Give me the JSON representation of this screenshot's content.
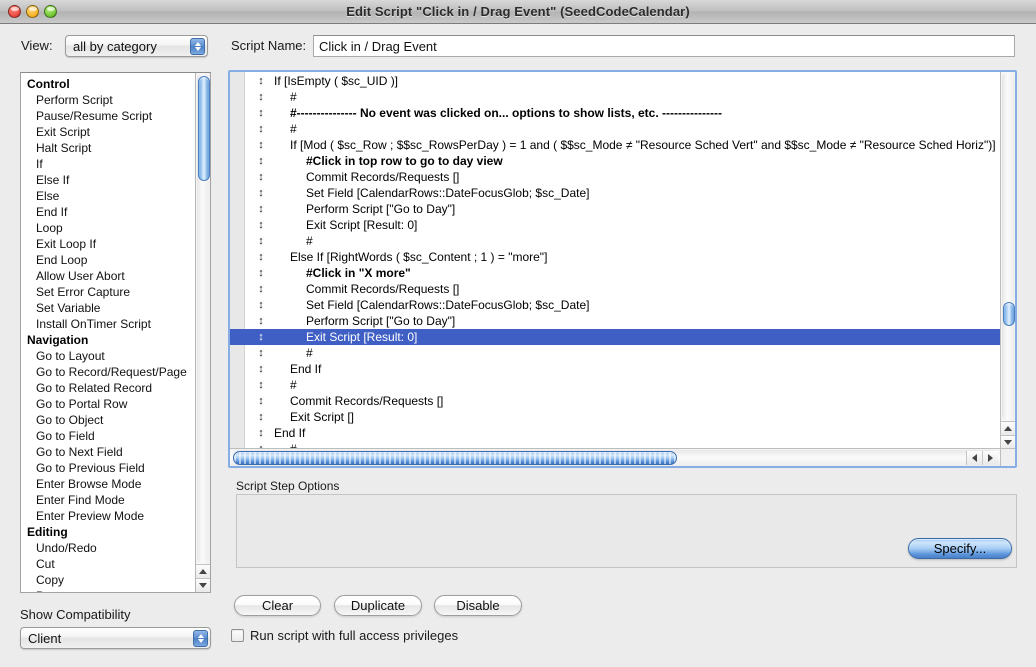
{
  "window": {
    "title": "Edit Script \"Click in / Drag Event\" (SeedCodeCalendar)",
    "close_icon": "close-icon",
    "minimize_icon": "minimize-icon",
    "zoom_icon": "zoom-icon"
  },
  "toolbar": {
    "view_label": "View:",
    "view_value": "all by category",
    "script_name_label": "Script Name:",
    "script_name_value": "Click in / Drag Event"
  },
  "sidebar": {
    "categories": [
      {
        "name": "Control",
        "items": [
          "Perform Script",
          "Pause/Resume Script",
          "Exit Script",
          "Halt Script",
          "If",
          "Else If",
          "Else",
          "End If",
          "Loop",
          "Exit Loop If",
          "End Loop",
          "Allow User Abort",
          "Set Error Capture",
          "Set Variable",
          "Install OnTimer Script"
        ]
      },
      {
        "name": "Navigation",
        "items": [
          "Go to Layout",
          "Go to Record/Request/Page",
          "Go to Related Record",
          "Go to Portal Row",
          "Go to Object",
          "Go to Field",
          "Go to Next Field",
          "Go to Previous Field",
          "Enter Browse Mode",
          "Enter Find Mode",
          "Enter Preview Mode"
        ]
      },
      {
        "name": "Editing",
        "items": [
          "Undo/Redo",
          "Cut",
          "Copy",
          "Paste"
        ]
      }
    ],
    "compatibility_label": "Show Compatibility",
    "compatibility_value": "Client"
  },
  "script": {
    "handle_glyph": "↕",
    "selected_index": 16,
    "lines": [
      {
        "indent": 0,
        "text": "If [IsEmpty ( $sc_UID )]",
        "bold": false
      },
      {
        "indent": 1,
        "text": "#",
        "bold": false
      },
      {
        "indent": 1,
        "text": "#---------------  No event was clicked on... options to show lists, etc.  ---------------",
        "bold": true
      },
      {
        "indent": 1,
        "text": "#",
        "bold": false
      },
      {
        "indent": 1,
        "text": "If [Mod ( $sc_Row ; $$sc_RowsPerDay ) = 1 and ( $$sc_Mode ≠ \"Resource Sched Vert\" and $$sc_Mode ≠ \"Resource Sched Horiz\")]",
        "bold": false
      },
      {
        "indent": 2,
        "text": "#Click in top row to go to day view",
        "bold": true
      },
      {
        "indent": 2,
        "text": "Commit Records/Requests []",
        "bold": false
      },
      {
        "indent": 2,
        "text": "Set Field [CalendarRows::DateFocusGlob; $sc_Date]",
        "bold": false
      },
      {
        "indent": 2,
        "text": "Perform Script [\"Go to Day\"]",
        "bold": false
      },
      {
        "indent": 2,
        "text": "Exit Script [Result: 0]",
        "bold": false
      },
      {
        "indent": 2,
        "text": "#",
        "bold": false
      },
      {
        "indent": 1,
        "text": "Else If [RightWords ( $sc_Content ; 1 ) = \"more\"]",
        "bold": false
      },
      {
        "indent": 2,
        "text": "#Click in \"X more\"",
        "bold": true
      },
      {
        "indent": 2,
        "text": "Commit Records/Requests []",
        "bold": false
      },
      {
        "indent": 2,
        "text": "Set Field [CalendarRows::DateFocusGlob; $sc_Date]",
        "bold": false
      },
      {
        "indent": 2,
        "text": "Perform Script [\"Go to Day\"]",
        "bold": false
      },
      {
        "indent": 2,
        "text": "Exit Script [Result: 0]",
        "bold": false
      },
      {
        "indent": 2,
        "text": "#",
        "bold": false
      },
      {
        "indent": 1,
        "text": "End If",
        "bold": false
      },
      {
        "indent": 1,
        "text": "#",
        "bold": false
      },
      {
        "indent": 1,
        "text": "Commit Records/Requests []",
        "bold": false
      },
      {
        "indent": 1,
        "text": "Exit Script []",
        "bold": false
      },
      {
        "indent": 0,
        "text": "End If",
        "bold": false
      },
      {
        "indent": 1,
        "text": "#",
        "bold": false
      }
    ]
  },
  "options": {
    "section_label": "Script Step Options",
    "specify_label": "Specify..."
  },
  "actions": {
    "clear_label": "Clear",
    "duplicate_label": "Duplicate",
    "disable_label": "Disable",
    "full_access_label": "Run script with full access privileges",
    "full_access_checked": false
  },
  "colors": {
    "selection_blue": "#3f5fc4",
    "focus_border": "#86aee4",
    "window_bg": "#ececec",
    "aqua_blue": "#5a93da"
  }
}
